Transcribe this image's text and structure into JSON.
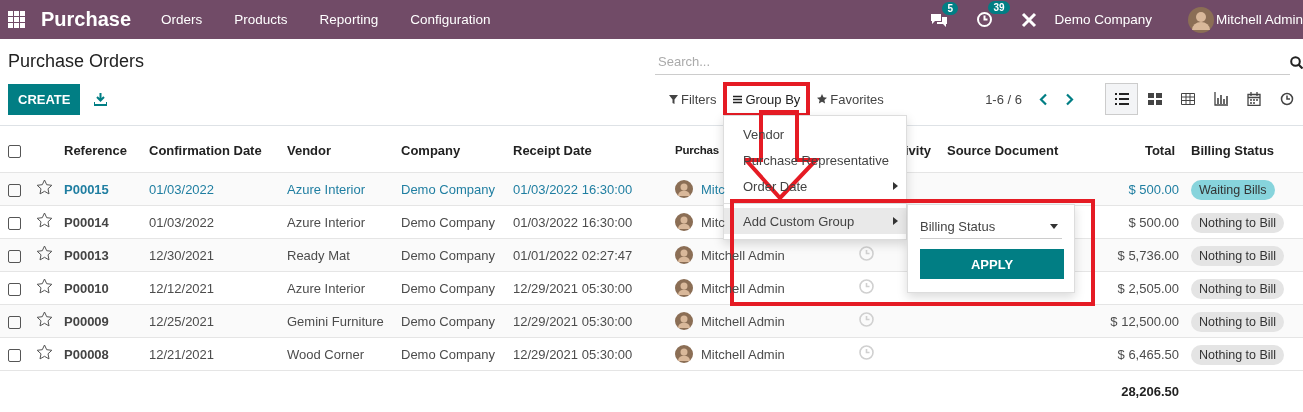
{
  "navbar": {
    "app_name": "Purchase",
    "menu": [
      "Orders",
      "Products",
      "Reporting",
      "Configuration"
    ],
    "messages_count": "5",
    "activities_count": "39",
    "company": "Demo Company",
    "user": "Mitchell Admin"
  },
  "control_panel": {
    "title": "Purchase Orders",
    "create_label": "CREATE",
    "search": {
      "placeholder": "Search..."
    },
    "filters_label": "Filters",
    "group_by": {
      "label": "Group By",
      "selected": true,
      "highlighted": true
    },
    "favorites_label": "Favorites",
    "pager": "1-6 / 6",
    "views": [
      {
        "kind": "list",
        "selected": true
      },
      {
        "kind": "kanban",
        "selected": false
      },
      {
        "kind": "pivot",
        "selected": false
      },
      {
        "kind": "graph",
        "selected": false
      },
      {
        "kind": "calendar",
        "selected": false
      },
      {
        "kind": "activity",
        "selected": false
      }
    ]
  },
  "table": {
    "all_checked": false,
    "columns": [
      "Reference",
      "Confirmation Date",
      "Vendor",
      "Company",
      "Receipt Date",
      "Purchas",
      "ivity",
      "Source Document",
      "Total",
      "Billing Status"
    ],
    "rows": [
      {
        "checked": false,
        "starred": false,
        "highlighted": true,
        "reference": "P00015",
        "confirmation_date": "01/03/2022",
        "vendor": "Azure Interior",
        "company": "Demo Company",
        "receipt_date": "01/03/2022 16:30:00",
        "representative": "Mitc",
        "activity_icon": false,
        "total": "$ 500.00",
        "billing_status": {
          "label": "Waiting Bills",
          "color": "#87d4dc"
        }
      },
      {
        "checked": false,
        "starred": false,
        "highlighted": false,
        "reference": "P00014",
        "confirmation_date": "01/03/2022",
        "vendor": "Azure Interior",
        "company": "Demo Company",
        "receipt_date": "01/03/2022 16:30:00",
        "representative": "Mitc",
        "activity_icon": false,
        "total": "$ 500.00",
        "billing_status": {
          "label": "Nothing to Bill",
          "color": "#e4e4e4"
        }
      },
      {
        "checked": false,
        "starred": false,
        "highlighted": false,
        "reference": "P00013",
        "confirmation_date": "12/30/2021",
        "vendor": "Ready Mat",
        "company": "Demo Company",
        "receipt_date": "01/01/2022 02:27:47",
        "representative": "Mitchell Admin",
        "activity_icon": true,
        "total": "$ 5,736.00",
        "billing_status": {
          "label": "Nothing to Bill",
          "color": "#e4e4e4"
        }
      },
      {
        "checked": false,
        "starred": false,
        "highlighted": false,
        "reference": "P00010",
        "confirmation_date": "12/12/2021",
        "vendor": "Azure Interior",
        "company": "Demo Company",
        "receipt_date": "12/29/2021 05:30:00",
        "representative": "Mitchell Admin",
        "activity_icon": true,
        "total": "$ 2,505.00",
        "billing_status": {
          "label": "Nothing to Bill",
          "color": "#e4e4e4"
        }
      },
      {
        "checked": false,
        "starred": false,
        "highlighted": false,
        "reference": "P00009",
        "confirmation_date": "12/25/2021",
        "vendor": "Gemini Furniture",
        "company": "Demo Company",
        "receipt_date": "12/29/2021 05:30:00",
        "representative": "Mitchell Admin",
        "activity_icon": true,
        "total": "$ 12,500.00",
        "billing_status": {
          "label": "Nothing to Bill",
          "color": "#e4e4e4"
        }
      },
      {
        "checked": false,
        "starred": false,
        "highlighted": false,
        "reference": "P00008",
        "confirmation_date": "12/21/2021",
        "vendor": "Wood Corner",
        "company": "Demo Company",
        "receipt_date": "12/29/2021 05:30:00",
        "representative": "Mitchell Admin",
        "activity_icon": true,
        "total": "$ 6,465.50",
        "billing_status": {
          "label": "Nothing to Bill",
          "color": "#e4e4e4"
        }
      }
    ],
    "total": "28,206.50"
  },
  "group_by_menu": {
    "items": [
      {
        "label": "Vendor",
        "submenu": false,
        "selected": false
      },
      {
        "label": "Purchase Representative",
        "submenu": false,
        "selected": false
      },
      {
        "label": "Order Date",
        "submenu": true,
        "selected": false
      },
      {
        "label": "Add Custom Group",
        "submenu": true,
        "selected": true,
        "divider_before": true
      }
    ]
  },
  "custom_group": {
    "field": "Billing Status",
    "apply_label": "APPLY",
    "highlighted": true
  },
  "annotation_arrow": true
}
